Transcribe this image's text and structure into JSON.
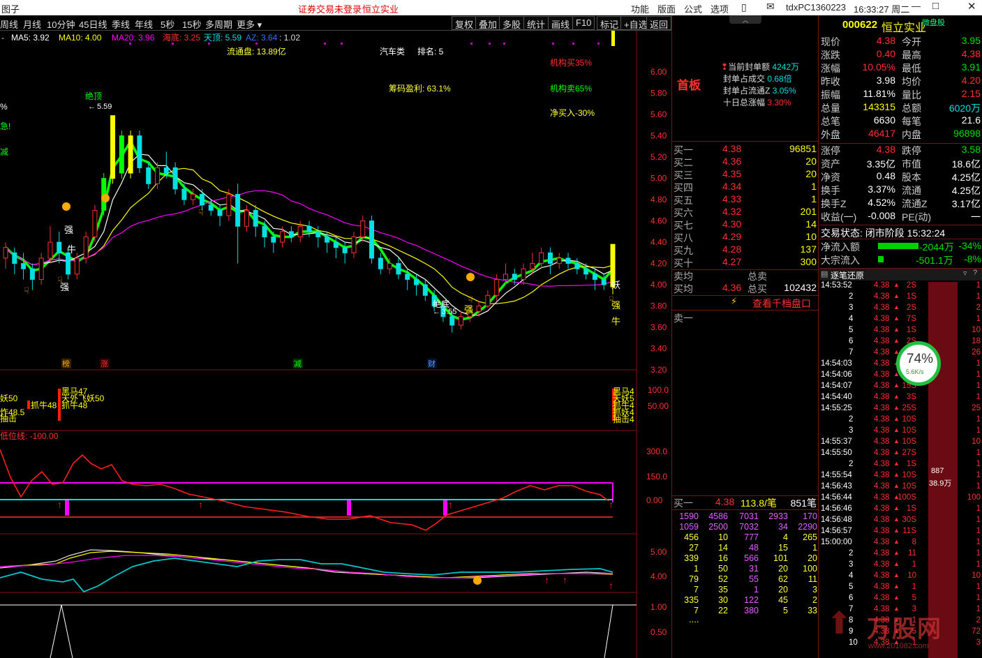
{
  "titlebar": {
    "left_title": "图子",
    "login_status": "证券交易未登录",
    "stock_name": "恒立实业",
    "menus": [
      "功能",
      "版面",
      "公式",
      "选项"
    ],
    "id_text": "tdxPC1360223",
    "clock": "16:33:27 周二"
  },
  "tabs": [
    "周线",
    "月线",
    "10分钟",
    "45日线",
    "季线",
    "年线",
    "5秒",
    "15秒",
    "多周期",
    "更多"
  ],
  "toolbar": [
    "复权",
    "叠加",
    "多股",
    "统计",
    "画线",
    "F10",
    "标记",
    "+自选",
    "返回"
  ],
  "ma_line": {
    "prefix": "-",
    "ma5": "MA5: 3.92",
    "ma10": "MA10: 4.00",
    "ma20": "MA20: 3.96",
    "haidi": "海底: 3.25",
    "tianding": "天顶: 5.59",
    "az": "AZ: 3.64",
    "ratio": ": 1.02"
  },
  "chart_annotations": {
    "float_cap": "流通盘: 13.89亿",
    "industry": "汽车类",
    "rank": "排名: 5",
    "chip_profit": "筹码盈利: 63.1%",
    "inst_buy": "机构买35%",
    "inst_sell": "机构卖65%",
    "net_buy": "净买入-30%",
    "peak_label": "绝顶",
    "peak_value": "5.59",
    "bottom_label": "绝底",
    "bottom_value": "3.55",
    "strong": "强",
    "bull": "牛",
    "demon": "妖",
    "pct_fragment": "%",
    "fragment_a": "急!",
    "fragment_b": "减",
    "badges": [
      "榜",
      "涨",
      "减",
      "财"
    ]
  },
  "price_axis": [
    "6.00",
    "5.80",
    "5.60",
    "5.40",
    "5.20",
    "5.00",
    "4.80",
    "4.60",
    "4.40",
    "4.20",
    "4.00",
    "3.80",
    "3.60",
    "3.40",
    "3.20"
  ],
  "panel2": {
    "axis": [
      "100.0",
      "50.00"
    ],
    "labels_left": [
      "妖50",
      "炸48.5",
      "抽击"
    ],
    "labels_a": [
      "黑马47",
      "天外飞妖50",
      "抓牛48"
    ],
    "label_b": "抓牛48",
    "labels_right": [
      "黑马4",
      "天妖5",
      "抓牛4",
      "抓妖4",
      "抽击4"
    ]
  },
  "panel3": {
    "title": "低位线: -100.00",
    "axis": [
      "300.0",
      "150.0",
      "0.00"
    ]
  },
  "panel4": {
    "axis": [
      "5.00",
      "4.00"
    ]
  },
  "panel5": {
    "axis": [
      "1.00",
      "0.50"
    ]
  },
  "mid": {
    "first_board": "首板",
    "seal_info": [
      {
        "label": "当前封单额",
        "value": "4242万"
      },
      {
        "label": "封单占成交",
        "value": "0.68倍"
      },
      {
        "label": "封单占流通Z",
        "value": "3.05%"
      },
      {
        "label": "十日总涨幅",
        "value": "3.30%"
      }
    ],
    "bids": [
      {
        "label": "买一",
        "price": "4.38",
        "vol": "96851"
      },
      {
        "label": "买二",
        "price": "4.36",
        "vol": "20"
      },
      {
        "label": "买三",
        "price": "4.35",
        "vol": "20"
      },
      {
        "label": "买四",
        "price": "4.34",
        "vol": "1"
      },
      {
        "label": "买五",
        "price": "4.33",
        "vol": "1"
      },
      {
        "label": "买六",
        "price": "4.32",
        "vol": "201"
      },
      {
        "label": "买七",
        "price": "4.30",
        "vol": "14"
      },
      {
        "label": "买八",
        "price": "4.29",
        "vol": "10"
      },
      {
        "label": "买九",
        "price": "4.28",
        "vol": "137"
      },
      {
        "label": "买十",
        "price": "4.27",
        "vol": "300"
      }
    ],
    "sell_avg_label": "卖均",
    "sell_total_label": "总卖",
    "buy_avg_label": "买均",
    "buy_avg": "4.36",
    "buy_total_label": "总买",
    "buy_total": "102432",
    "view_orders": "查看千档盘口",
    "sell_one": "卖一",
    "queue_header": {
      "label": "买一",
      "price": "4.38",
      "per": "113.8/笔",
      "count": "851笔"
    },
    "queue": [
      [
        "1590",
        "4586",
        "7031",
        "2933",
        "170"
      ],
      [
        "1059",
        "2500",
        "7032",
        "34",
        "2290"
      ],
      [
        "456",
        "10",
        "777",
        "4",
        "265"
      ],
      [
        "27",
        "14",
        "48",
        "15",
        "1"
      ],
      [
        "339",
        "16",
        "566",
        "101",
        "20"
      ],
      [
        "1",
        "50",
        "31",
        "20",
        "100"
      ],
      [
        "79",
        "52",
        "55",
        "62",
        "11"
      ],
      [
        "7",
        "35",
        "1",
        "20",
        "3"
      ],
      [
        "335",
        "30",
        "122",
        "45",
        "2"
      ],
      [
        "7",
        "22",
        "380",
        "5",
        "33"
      ]
    ],
    "queue_more": "...."
  },
  "right": {
    "code": "000622",
    "name": "恒立实业",
    "tag": "微盘股",
    "quote": [
      [
        "现价",
        "4.38",
        "red",
        "今开",
        "3.95",
        "green"
      ],
      [
        "涨跌",
        "0.40",
        "red",
        "最高",
        "4.38",
        "red"
      ],
      [
        "涨幅",
        "10.05%",
        "red",
        "最低",
        "3.91",
        "green"
      ],
      [
        "昨收",
        "3.98",
        "white",
        "均价",
        "4.20",
        "red"
      ],
      [
        "振幅",
        "11.81%",
        "white",
        "量比",
        "2.15",
        "red"
      ],
      [
        "总量",
        "143315",
        "yellow",
        "总额",
        "6020万",
        "cyan"
      ],
      [
        "总笔",
        "6630",
        "white",
        "每笔",
        "21.6",
        "white"
      ],
      [
        "外盘",
        "46417",
        "red",
        "内盘",
        "96898",
        "green"
      ]
    ],
    "quote2": [
      [
        "涨停",
        "4.38",
        "red",
        "跌停",
        "3.58",
        "green"
      ],
      [
        "资产",
        "3.35亿",
        "white",
        "市值",
        "18.6亿",
        "white"
      ],
      [
        "净资",
        "0.48",
        "white",
        "股本",
        "4.25亿",
        "white"
      ],
      [
        "换手",
        "3.37%",
        "white",
        "流通",
        "4.25亿",
        "white"
      ],
      [
        "换手Z",
        "4.52%",
        "white",
        "流通Z",
        "3.17亿",
        "white"
      ],
      [
        "收益(一)",
        "-0.008",
        "white",
        "PE(动)",
        "一",
        "white"
      ]
    ],
    "trade_status": "交易状态: 闭市阶段 15:32:24",
    "net_inflow_label": "净流入额",
    "net_inflow": "-2044万",
    "net_inflow_pct": "-34%",
    "block_label": "大宗流入",
    "block": "-501.1万",
    "block_pct": "-8%",
    "tick_title": "逐笔还原",
    "ticks": [
      [
        "14:53:52",
        "4.38",
        "2S",
        "1"
      ],
      [
        "2",
        "4.38",
        "1S",
        "1"
      ],
      [
        "3",
        "4.38",
        "2S",
        "2"
      ],
      [
        "4",
        "4.38",
        "7S",
        "1"
      ],
      [
        "5",
        "4.38",
        "1S",
        "10"
      ],
      [
        "6",
        "4.38",
        "2S",
        "18"
      ],
      [
        "7",
        "4.38",
        "2S",
        "26"
      ],
      [
        "14:54:03",
        "4.38",
        "2S",
        "1"
      ],
      [
        "14:54:06",
        "4.38",
        "1S",
        "1"
      ],
      [
        "14:54:07",
        "4.38",
        "15S",
        "1"
      ],
      [
        "14:54:40",
        "4.38",
        "3S",
        "1"
      ],
      [
        "14:55:25",
        "4.38",
        "25S",
        "25"
      ],
      [
        "2",
        "4.38",
        "10S",
        "1"
      ],
      [
        "3",
        "4.38",
        "10S",
        "1"
      ],
      [
        "14:55:37",
        "4.38",
        "10S",
        "10"
      ],
      [
        "14:55:50",
        "4.38",
        "27S",
        "1"
      ],
      [
        "2",
        "4.38",
        "1S",
        "1"
      ],
      [
        "14:55:54",
        "4.38",
        "10S",
        "1"
      ],
      [
        "14:56:43",
        "4.38",
        "10S",
        "1"
      ],
      [
        "14:56:44",
        "4.38",
        "100S",
        "100"
      ],
      [
        "14:56:46",
        "4.38",
        "1S",
        "1"
      ],
      [
        "14:56:48",
        "4.38",
        "30S",
        "1"
      ],
      [
        "14:56:57",
        "4.38",
        "11S",
        "1"
      ],
      [
        "15:00:00",
        "4.38",
        "8",
        "1"
      ],
      [
        "2",
        "4.38",
        "11",
        "1"
      ],
      [
        "3",
        "4.38",
        "1",
        "1"
      ],
      [
        "4",
        "4.38",
        "10",
        "10"
      ],
      [
        "5",
        "4.38",
        "1",
        "1"
      ],
      [
        "6",
        "4.38",
        "5",
        "1"
      ],
      [
        "7",
        "4.38",
        "3",
        "1"
      ],
      [
        "8",
        "4.38",
        "1",
        "2"
      ],
      [
        "9",
        "4.38",
        "5",
        "72"
      ],
      [
        "10",
        "4.38",
        "1",
        "3"
      ]
    ],
    "speed_pct": "74%",
    "speed_rate": "5.6K/s",
    "bar_label1": "887",
    "bar_label2": "38.9万",
    "watermark": "万股网",
    "watermark_url": "www.201082.com"
  },
  "colors": {
    "up": "#ff3030",
    "down": "#00e0e0",
    "ma5": "#ffffff",
    "ma10": "#ffff00",
    "ma20": "#ff00ff",
    "green_line": "#00ff00"
  },
  "chart_data": {
    "type": "candlestick",
    "ylim": [
      3.2,
      6.1
    ],
    "candles": [
      [
        4.25,
        4.35,
        4.15,
        4.4
      ],
      [
        4.3,
        4.2,
        4.1,
        4.35
      ],
      [
        4.2,
        4.15,
        4.05,
        4.3
      ],
      [
        4.15,
        4.05,
        3.95,
        4.2
      ],
      [
        4.05,
        4.25,
        4.0,
        4.3
      ],
      [
        4.25,
        4.4,
        4.2,
        4.55
      ],
      [
        4.4,
        4.3,
        4.2,
        4.5
      ],
      [
        4.3,
        4.1,
        4.05,
        4.35
      ],
      [
        4.1,
        4.25,
        4.05,
        4.3
      ],
      [
        4.25,
        4.45,
        4.2,
        4.5
      ],
      [
        4.45,
        4.7,
        4.4,
        4.75
      ],
      [
        4.7,
        5.0,
        4.65,
        5.05
      ],
      [
        5.0,
        5.59,
        4.95,
        5.59
      ],
      [
        5.4,
        5.05,
        5.0,
        5.45
      ],
      [
        5.05,
        5.4,
        5.0,
        5.45
      ],
      [
        5.4,
        5.1,
        5.05,
        5.45
      ],
      [
        5.1,
        4.95,
        4.9,
        5.15
      ],
      [
        4.95,
        5.1,
        4.9,
        5.15
      ],
      [
        5.1,
        5.05,
        5.0,
        5.25
      ],
      [
        5.1,
        4.9,
        4.85,
        5.15
      ],
      [
        4.9,
        4.8,
        4.75,
        4.95
      ],
      [
        4.8,
        4.85,
        4.75,
        4.9
      ],
      [
        4.85,
        4.75,
        4.7,
        4.9
      ],
      [
        4.75,
        4.7,
        4.65,
        4.8
      ],
      [
        4.7,
        4.65,
        4.55,
        4.75
      ],
      [
        4.65,
        4.85,
        4.6,
        4.9
      ],
      [
        4.85,
        4.55,
        4.2,
        4.95
      ],
      [
        4.55,
        4.7,
        4.5,
        4.75
      ],
      [
        4.7,
        4.55,
        4.45,
        4.75
      ],
      [
        4.55,
        4.45,
        4.35,
        4.6
      ],
      [
        4.45,
        4.4,
        4.3,
        4.5
      ],
      [
        4.4,
        4.5,
        4.35,
        4.55
      ],
      [
        4.5,
        4.45,
        4.4,
        4.55
      ],
      [
        4.45,
        4.55,
        4.4,
        4.6
      ],
      [
        4.55,
        4.5,
        4.45,
        4.6
      ],
      [
        4.5,
        4.45,
        4.35,
        4.55
      ],
      [
        4.45,
        4.4,
        4.3,
        4.5
      ],
      [
        4.4,
        4.35,
        4.25,
        4.45
      ],
      [
        4.35,
        4.3,
        4.2,
        4.4
      ],
      [
        4.3,
        4.45,
        4.25,
        4.5
      ],
      [
        4.45,
        4.6,
        4.4,
        4.65
      ],
      [
        4.6,
        4.25,
        4.2,
        4.65
      ],
      [
        4.25,
        4.15,
        4.1,
        4.3
      ],
      [
        4.15,
        4.2,
        4.1,
        4.25
      ],
      [
        4.2,
        4.1,
        4.05,
        4.25
      ],
      [
        4.1,
        4.05,
        3.95,
        4.15
      ],
      [
        4.05,
        4.0,
        3.9,
        4.1
      ],
      [
        4.0,
        3.9,
        3.85,
        4.05
      ],
      [
        3.9,
        3.8,
        3.75,
        3.95
      ],
      [
        3.8,
        3.7,
        3.65,
        3.85
      ],
      [
        3.7,
        3.62,
        3.55,
        3.75
      ],
      [
        3.62,
        3.7,
        3.58,
        3.75
      ],
      [
        3.7,
        3.75,
        3.65,
        3.8
      ],
      [
        3.75,
        3.8,
        3.7,
        3.85
      ],
      [
        3.8,
        3.9,
        3.78,
        3.95
      ],
      [
        3.9,
        4.05,
        3.85,
        4.1
      ],
      [
        4.05,
        4.1,
        4.0,
        4.2
      ],
      [
        4.1,
        4.05,
        4.0,
        4.15
      ],
      [
        4.05,
        4.15,
        4.0,
        4.2
      ],
      [
        4.15,
        4.2,
        4.1,
        4.3
      ],
      [
        4.2,
        4.3,
        4.15,
        4.35
      ],
      [
        4.3,
        4.2,
        4.1,
        4.35
      ],
      [
        4.2,
        4.25,
        4.15,
        4.3
      ],
      [
        4.25,
        4.2,
        4.15,
        4.3
      ],
      [
        4.2,
        4.15,
        4.1,
        4.25
      ],
      [
        4.15,
        4.1,
        4.05,
        4.2
      ],
      [
        4.1,
        4.05,
        3.95,
        4.15
      ],
      [
        4.05,
        4.0,
        3.95,
        4.1
      ],
      [
        3.98,
        4.38,
        3.91,
        4.38
      ]
    ]
  }
}
